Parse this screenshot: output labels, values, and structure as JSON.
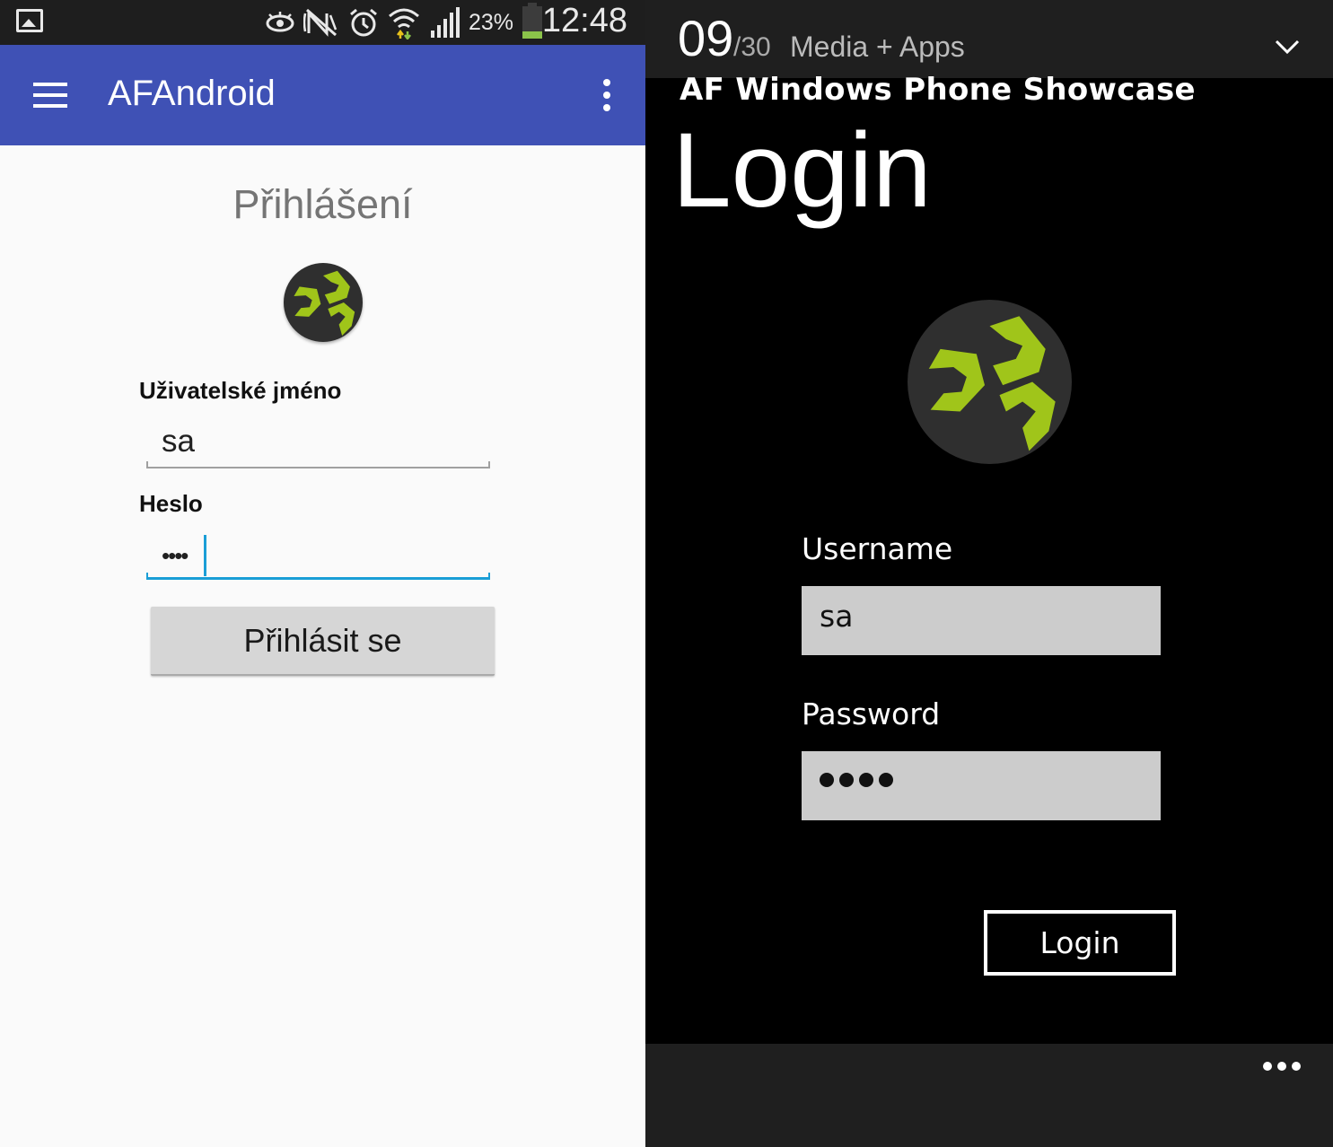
{
  "android": {
    "status_bar": {
      "battery_percent": "23%",
      "battery_level": 0.23,
      "time": "12:48",
      "icons": [
        "gallery-icon",
        "eye-icon",
        "nfc-icon",
        "alarm-icon",
        "wifi-icon",
        "signal-icon",
        "battery-icon"
      ]
    },
    "toolbar": {
      "title": "AFAndroid",
      "menu_icon": "hamburger-icon",
      "overflow_icon": "more-vert-icon"
    },
    "heading": "Přihlášení",
    "username_label": "Uživatelské jméno",
    "username_value": "sa",
    "password_label": "Heslo",
    "password_mask": "••••",
    "login_button": "Přihlásit se",
    "colors": {
      "toolbar": "#3f51b5",
      "accent": "#1a9ed6",
      "logo_green": "#a0c51a"
    }
  },
  "wp": {
    "header": {
      "day": "09",
      "total": "/30",
      "name": "Media + Apps"
    },
    "app_title": "AF Windows Phone Showcase",
    "page_title": "Login",
    "username_label": "Username",
    "username_value": "sa",
    "password_label": "Password",
    "password_length": 4,
    "login_button": "Login",
    "colors": {
      "background": "#000000",
      "input": "#cccccc",
      "bar": "#1f1f1f"
    }
  }
}
